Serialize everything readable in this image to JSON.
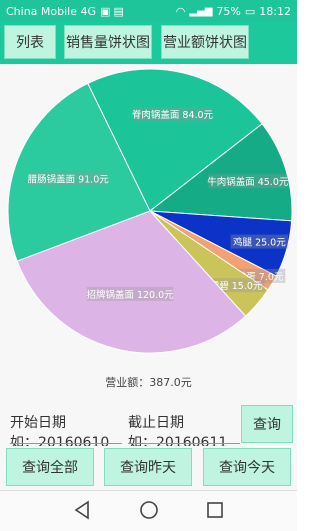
{
  "status_bar": {
    "carrier": "China Mobile 4G",
    "battery": "75%",
    "time": "18:12",
    "icons": [
      "sim-icon",
      "image-icon",
      "wifi-icon",
      "signal-icon",
      "signal-icon",
      "battery-icon"
    ]
  },
  "tabs": [
    {
      "label": "列表"
    },
    {
      "label": "销售量饼状图"
    },
    {
      "label": "营业额饼状图"
    }
  ],
  "total_label": "营业额：387.0元",
  "date_start": {
    "label": "开始日期",
    "value": "如：20160610"
  },
  "date_end": {
    "label": "截止日期",
    "value": "如：20160611"
  },
  "query_label": "查询",
  "buttons": [
    {
      "label": "查询全部"
    },
    {
      "label": "查询昨天"
    },
    {
      "label": "查询今天"
    }
  ],
  "nav_icons": [
    "back-icon",
    "home-icon",
    "recents-icon"
  ],
  "chart_data": {
    "type": "pie",
    "title": "",
    "slices": [
      {
        "label": "脊肉锅盖面 84.0元",
        "value": 84.0,
        "color": "#1cc49a"
      },
      {
        "label": "牛肉锅盖面 45.0元",
        "value": 45.0,
        "color": "#14ab86"
      },
      {
        "label": "鸡腿 25.0元",
        "value": 25.0,
        "color": "#0c33c8"
      },
      {
        "label": "煎蛋 7.0元",
        "value": 7.0,
        "color": "#f3a072"
      },
      {
        "label": "雪碧 15.0元",
        "value": 15.0,
        "color": "#cbc45a"
      },
      {
        "label": "招牌锅盖面 120.0元",
        "value": 120.0,
        "color": "#dcb5e6"
      },
      {
        "label": "腊肠锅盖面 91.0元",
        "value": 91.0,
        "color": "#2bcb9f"
      }
    ]
  }
}
